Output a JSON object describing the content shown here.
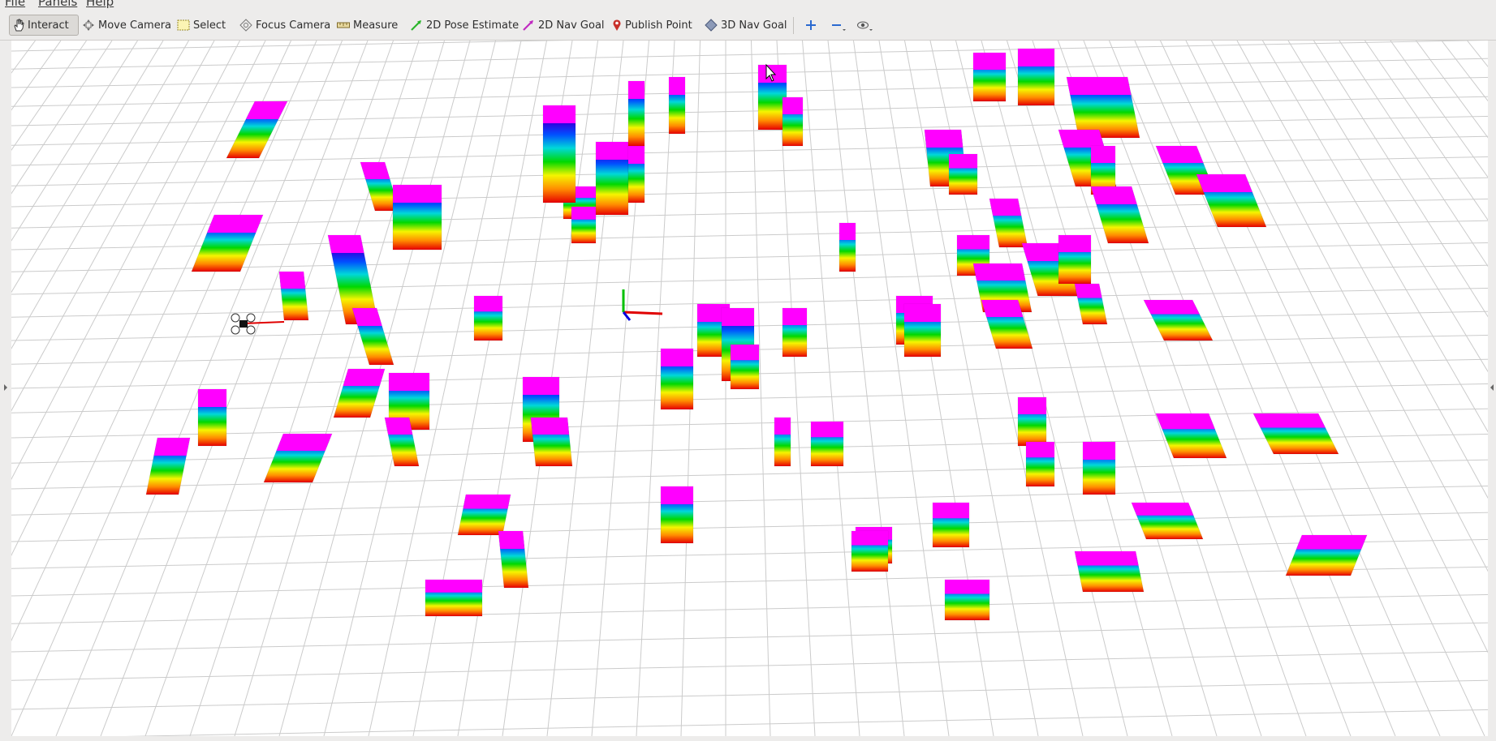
{
  "menu": {
    "items": [
      {
        "label": "File"
      },
      {
        "label": "Panels"
      },
      {
        "label": "Help"
      }
    ]
  },
  "toolbar": {
    "tools": [
      {
        "label": "Interact",
        "icon": "hand-icon",
        "active": true
      },
      {
        "label": "Move Camera",
        "icon": "move-camera-icon"
      },
      {
        "label": "Select",
        "icon": "select-box-icon"
      },
      {
        "label": "Focus Camera",
        "icon": "focus-camera-icon"
      },
      {
        "label": "Measure",
        "icon": "ruler-icon"
      },
      {
        "label": "2D Pose Estimate",
        "icon": "green-arrow-icon"
      },
      {
        "label": "2D Nav Goal",
        "icon": "magenta-arrow-icon"
      },
      {
        "label": "Publish Point",
        "icon": "map-pin-icon"
      },
      {
        "label": "3D Nav Goal",
        "icon": "diamond-icon"
      }
    ],
    "extra_icons": [
      "plus-icon",
      "minus-icon",
      "eye-icon"
    ]
  },
  "colors": {
    "chrome": "#edeceb",
    "grid": "#c9c9c9",
    "axis_x": "#e00000",
    "axis_y": "#00c000",
    "axis_z": "#0000e0",
    "obstacle_gradient": [
      "#e60000",
      "#ff8c00",
      "#f5f500",
      "#00d800",
      "#00d8d8",
      "#0050ff",
      "#3000e0",
      "#ff00ff"
    ]
  },
  "viewport": {
    "display": "3D point cloud of rainbow height-colored obstacle voxels on grid",
    "icons": [
      "origin-axes-icon",
      "drone-icon",
      "cursor-icon"
    ]
  }
}
